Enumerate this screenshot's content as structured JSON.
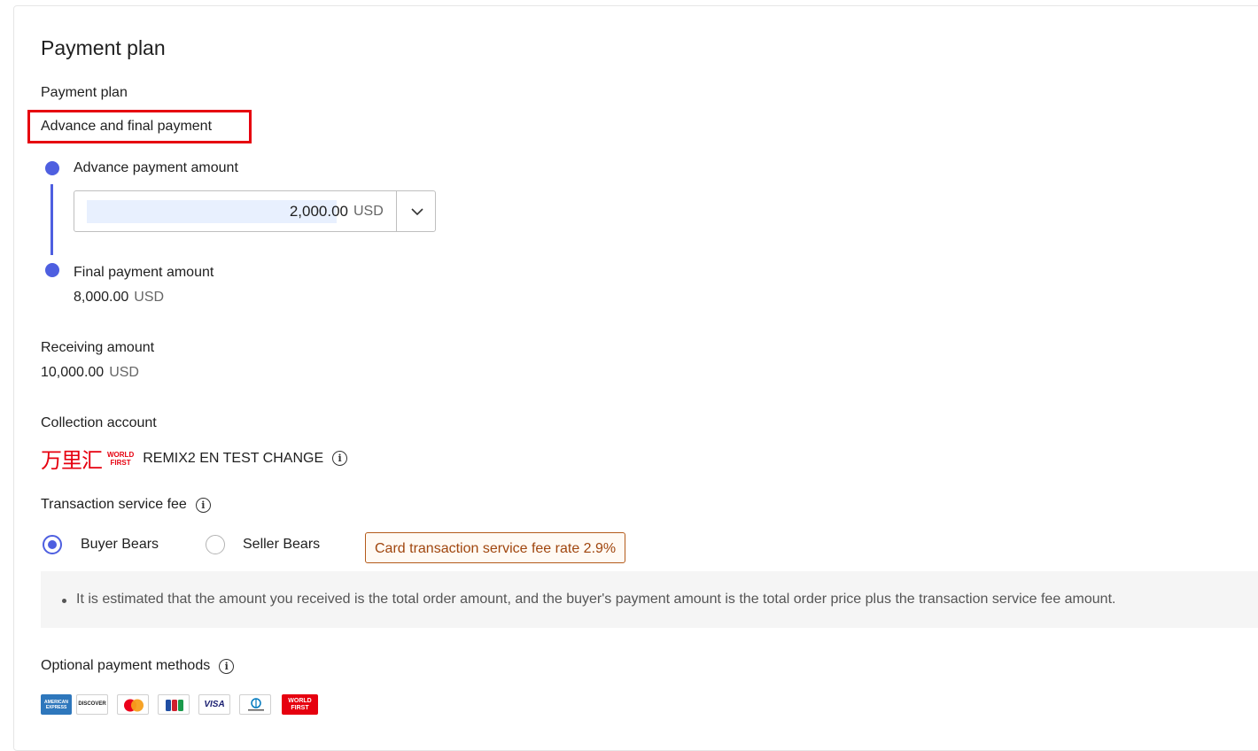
{
  "page": {
    "title": "Payment plan"
  },
  "plan": {
    "label": "Payment plan",
    "value": "Advance and final payment"
  },
  "advance": {
    "label": "Advance payment amount",
    "amount": "2,000.00",
    "currency": "USD"
  },
  "final": {
    "label": "Final payment amount",
    "amount": "8,000.00",
    "currency": "USD"
  },
  "receiving": {
    "label": "Receiving amount",
    "amount": "10,000.00",
    "currency": "USD"
  },
  "collection": {
    "label": "Collection account",
    "logo_cn": "万里汇",
    "logo_en_1": "WORLD",
    "logo_en_2": "FIRST",
    "account_name": "REMIX2 EN TEST CHANGE"
  },
  "fee": {
    "label": "Transaction service fee",
    "options": [
      "Buyer Bears",
      "Seller Bears"
    ],
    "selected": "Buyer Bears",
    "rate_badge": "Card transaction service fee rate 2.9%",
    "note": "It is estimated that the amount you received is the total order amount, and the buyer's payment amount is the total order price plus the transaction service fee amount."
  },
  "methods": {
    "label": "Optional payment methods",
    "icons": [
      "amex-icon",
      "discover-icon",
      "mastercard-icon",
      "jcb-icon",
      "visa-icon",
      "diners-club-icon",
      "world-first-icon"
    ],
    "amex_text": "AMERICAN EXPRESS",
    "discover_text": "DISCOVER",
    "visa_text": "VISA",
    "worldfirst_text_1": "WORLD",
    "worldfirst_text_2": "FIRST"
  },
  "colors": {
    "accent": "#4e5fe0",
    "highlight": "#e6000f",
    "badge": "#a0460e"
  }
}
